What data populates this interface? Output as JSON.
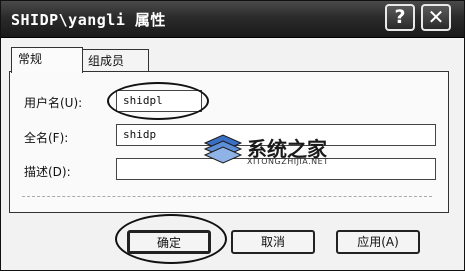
{
  "window": {
    "title": "SHIDP\\yangli 属性",
    "help_glyph": "?",
    "close_glyph": "✕"
  },
  "tabs": [
    {
      "label": "常规",
      "active": true
    },
    {
      "label": "组成员",
      "active": false
    }
  ],
  "fields": {
    "username": {
      "label": "用户名(U):",
      "value": "shidpl"
    },
    "fullname": {
      "label": "全名(F):",
      "value": "shidp"
    },
    "description": {
      "label": "描述(D):",
      "value": ""
    }
  },
  "watermark": {
    "text": "系统之家",
    "subtext": "XITONGZHIJIA.NET"
  },
  "buttons": {
    "ok": "确定",
    "cancel": "取消",
    "apply": "应用(A)"
  }
}
